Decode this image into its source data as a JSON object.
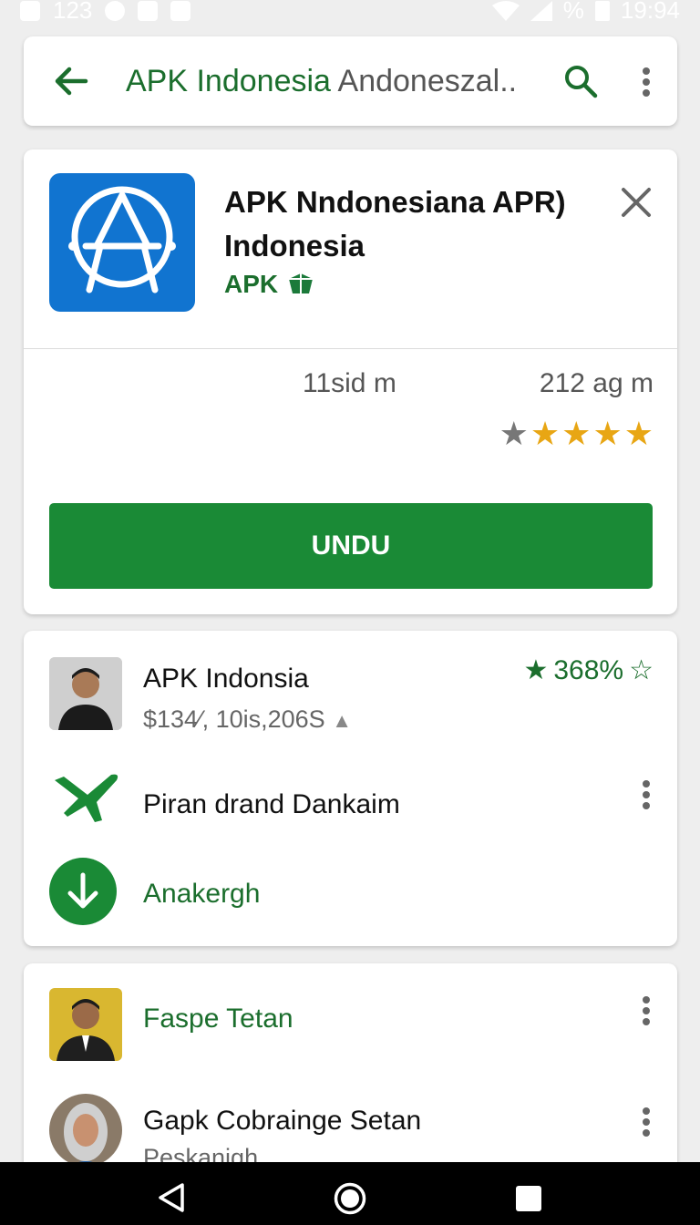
{
  "status_bar": {
    "left_text": "123",
    "battery": "%",
    "time": "19:94"
  },
  "search_bar": {
    "query": "APK Indonesia",
    "suggestion": "Andoneszal..",
    "icons": [
      "back-arrow-icon",
      "search-icon",
      "more-vert-icon"
    ]
  },
  "app": {
    "name": "APK Nndonesiana APR) Indonesia",
    "developer": "APK",
    "stat_left": "11sid m",
    "stat_right": "212 ag m",
    "rating": 4,
    "install_label": "UNDU",
    "accent_color": "#1a8a36"
  },
  "list1": {
    "item1": {
      "title": "APK Indonsia",
      "subtitle": "$134⁄, 10is,206S",
      "rating": "368%"
    },
    "item2": {
      "title": "Piran drand Dankaim"
    },
    "item3": {
      "title": "Anakergh"
    }
  },
  "list2": {
    "item1": {
      "title": "Faspe Tetan"
    },
    "item2": {
      "title": "Gapk Cobrainge Setan",
      "subtitle": "Peskanigh"
    }
  }
}
